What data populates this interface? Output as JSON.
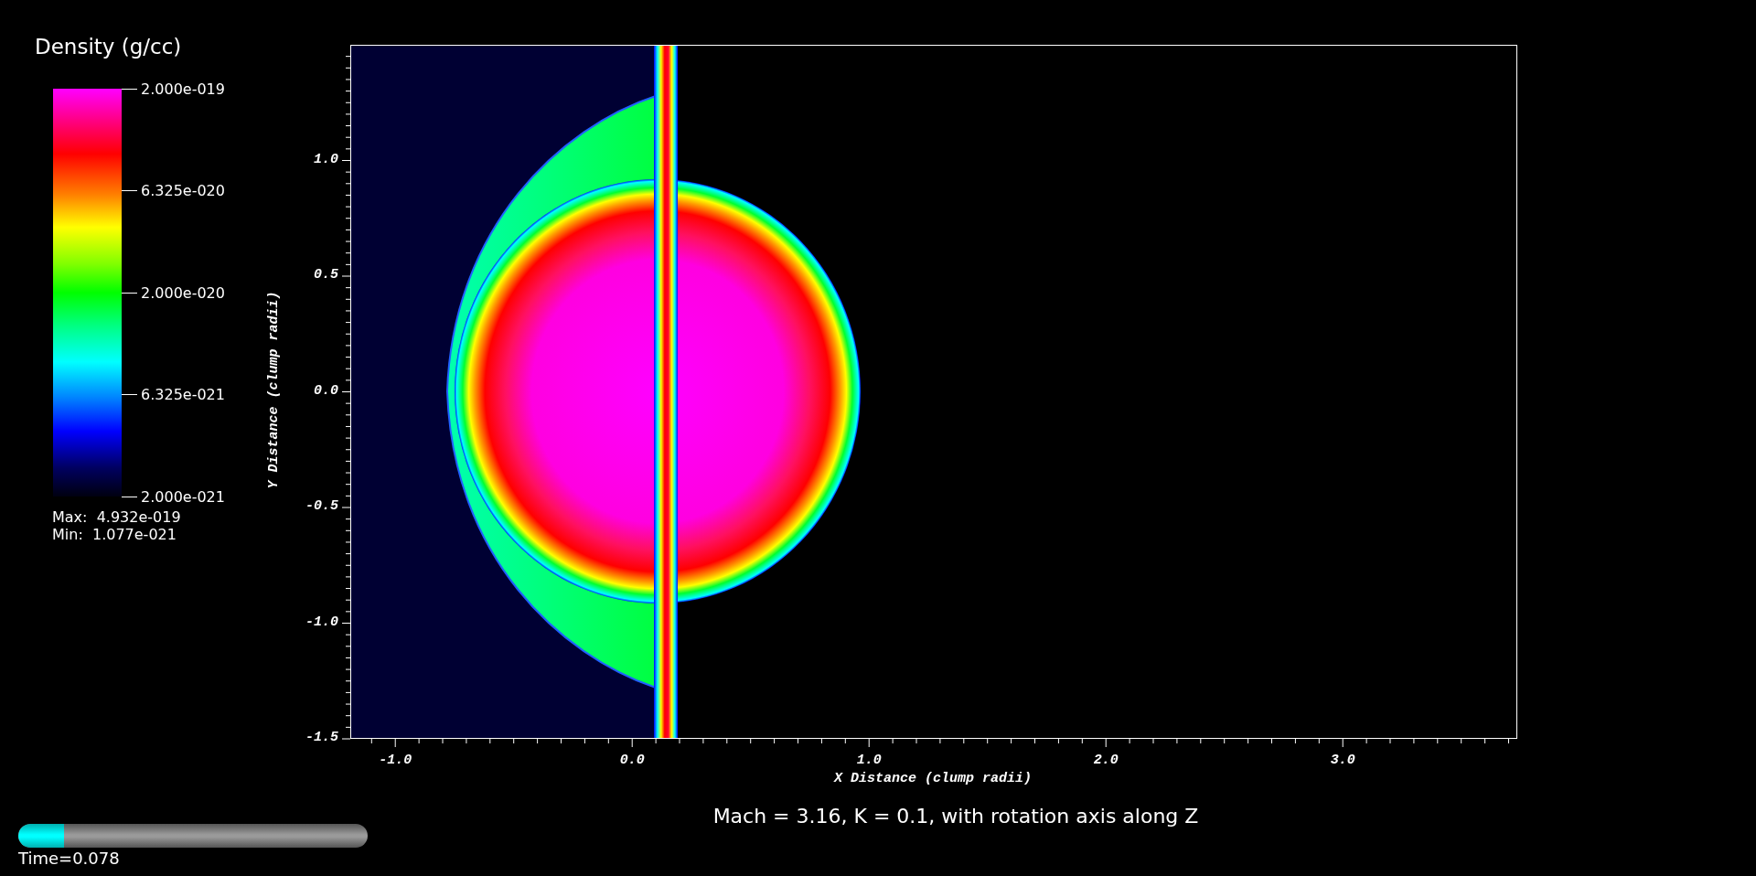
{
  "colorbar": {
    "title": "Density (g/cc)",
    "labels": [
      "2.000e-019",
      "6.325e-020",
      "2.000e-020",
      "6.325e-021",
      "2.000e-021"
    ],
    "max": "Max:  4.932e-019",
    "min": "Min:  1.077e-021"
  },
  "plot": {
    "x_axis": {
      "title": "X Distance (clump radii)",
      "ticks": [
        "-1.0",
        "0.0",
        "1.0",
        "2.0",
        "3.0"
      ]
    },
    "y_axis": {
      "title": "Y Distance (clump radii)",
      "ticks": [
        "1.0",
        "0.5",
        "0.0",
        "-0.5",
        "-1.0",
        "-1.5"
      ]
    }
  },
  "caption": "Mach = 3.16, K = 0.1, with rotation axis along Z",
  "time_slider": {
    "level": 0.13,
    "label": "Time=0.078"
  }
}
